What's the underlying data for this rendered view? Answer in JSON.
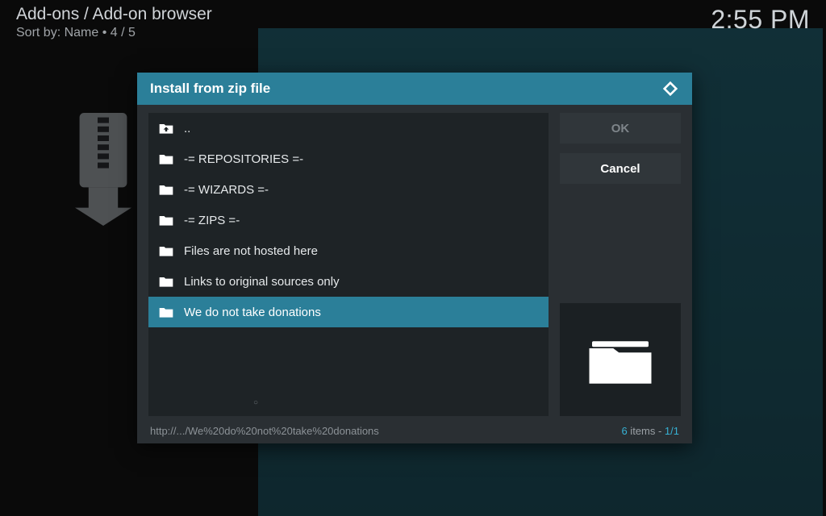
{
  "breadcrumb": "Add-ons / Add-on browser",
  "sort_prefix": "Sort by: ",
  "sort_value": "Name   •   4 / 5",
  "clock": "2:55 PM",
  "dialog": {
    "title": "Install from zip file",
    "buttons": {
      "ok": "OK",
      "cancel": "Cancel"
    },
    "items": [
      {
        "label": "..",
        "type": "up",
        "selected": false
      },
      {
        "label": "-= REPOSITORIES  =-",
        "type": "folder",
        "selected": false
      },
      {
        "label": "-= WIZARDS =-",
        "type": "folder",
        "selected": false
      },
      {
        "label": "-= ZIPS =-",
        "type": "folder",
        "selected": false
      },
      {
        "label": "Files are not hosted here",
        "type": "folder",
        "selected": false
      },
      {
        "label": "Links to original sources only",
        "type": "folder",
        "selected": false
      },
      {
        "label": "We do not take donations",
        "type": "folder",
        "selected": true
      }
    ],
    "footer": {
      "path": "http://.../We%20do%20not%20take%20donations",
      "count_num": "6",
      "count_label": " items - ",
      "page": "1/1"
    }
  }
}
